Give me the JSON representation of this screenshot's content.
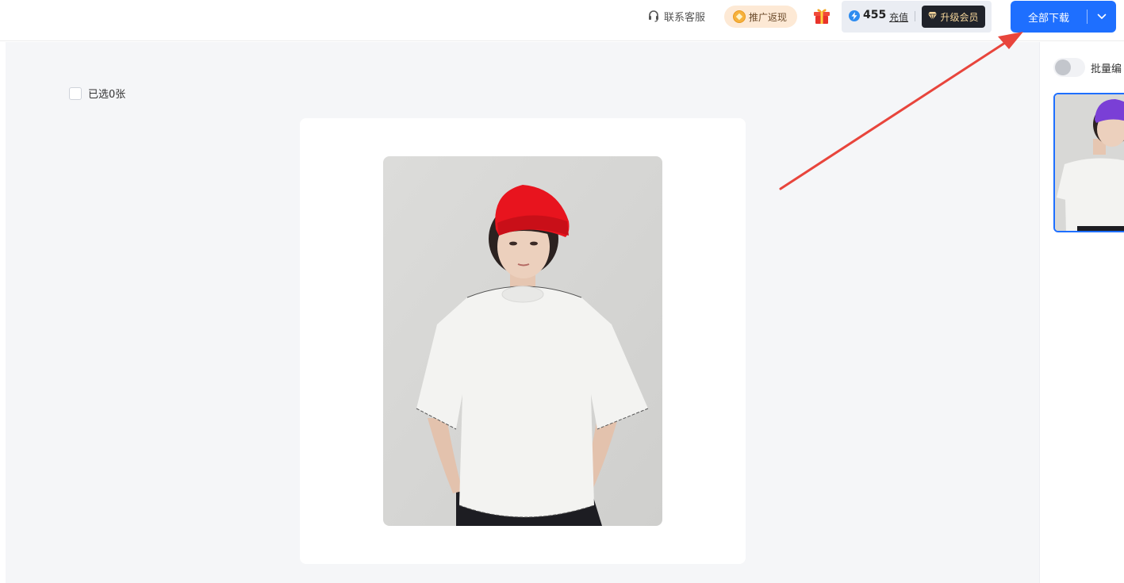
{
  "header": {
    "support_label": "联系客服",
    "promo_label": "推广返现",
    "credits": "455",
    "recharge_label": "充值",
    "upgrade_label": "升级会员",
    "download_all_label": "全部下载",
    "icons": {
      "support": "headset-icon",
      "promo": "coin-icon",
      "gift": "gift-icon",
      "credits": "lightning-icon",
      "upgrade": "diamond-icon",
      "download_menu": "chevron-down-icon"
    }
  },
  "main": {
    "selected_count_label": "已选0张",
    "preview_image": "model-red-beanie-white-tshirt"
  },
  "sidebar": {
    "batch_edit_label": "批量编",
    "toggle_on": false,
    "thumbnail_image": "model-purple-beanie-white-tshirt"
  },
  "annotation": {
    "type": "arrow",
    "color": "#e8453c",
    "points_to": "download-all-button"
  },
  "colors": {
    "primary": "#1e6fff",
    "workspace_bg": "#f5f6f8",
    "promo_bg": "#fde9d5",
    "upgrade_bg": "#20232a",
    "upgrade_text": "#f4d59a",
    "hat_preview": "#e8141e",
    "hat_thumbnail": "#7a3fd6"
  }
}
